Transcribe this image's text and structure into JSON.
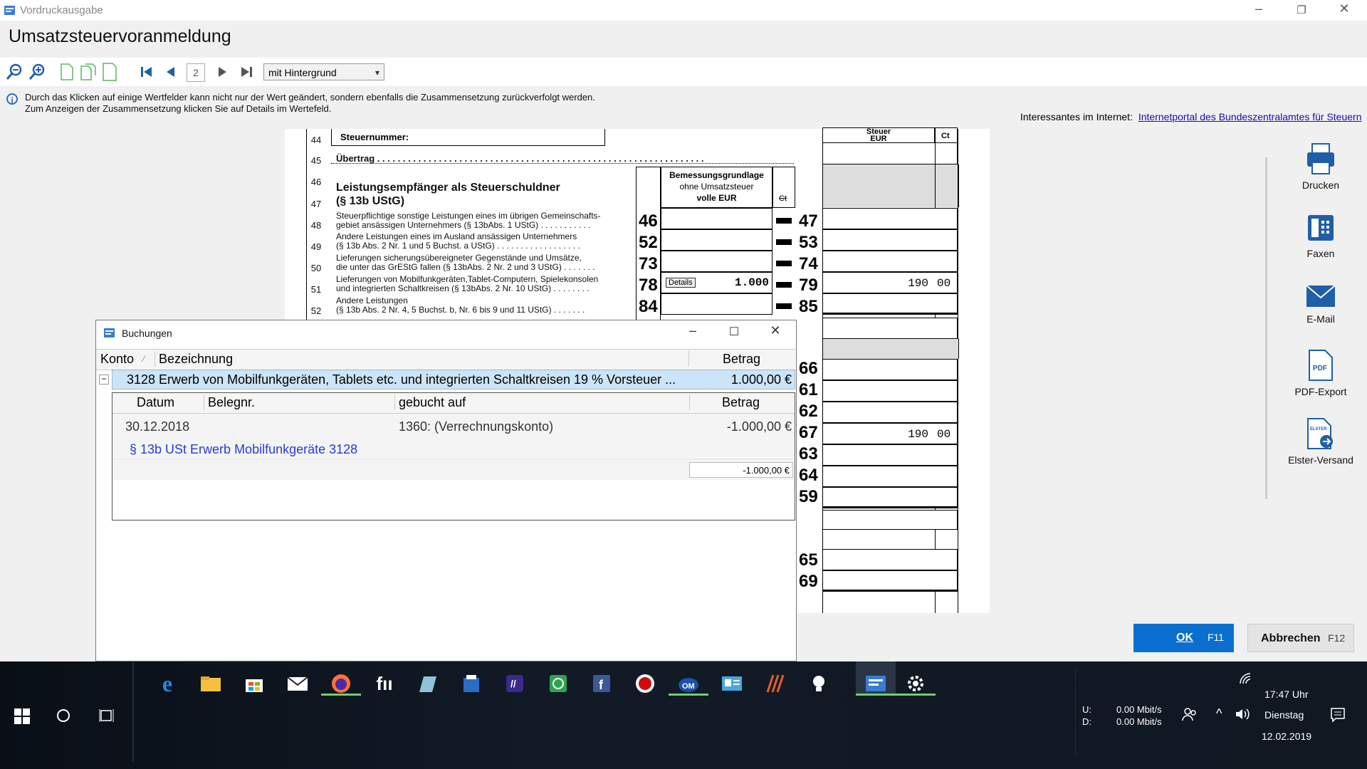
{
  "window": {
    "title": "Vordruckausgabe",
    "heading": "Umsatzsteuervoranmeldung"
  },
  "toolbar": {
    "page_number": "2",
    "view_select": "mit Hintergrund"
  },
  "info": {
    "line1": "Durch das Klicken auf einige Wertfelder kann nicht nur der Wert geändert, sondern ebenfalls die Zusammensetzung zurückverfolgt werden.",
    "line2": "Zum Anzeigen der Zusammensetzung klicken Sie auf Details im Wertefeld.",
    "internet_label": "Interessantes im Internet:",
    "internet_link": "Internetportal des Bundeszentralamtes für Steuern"
  },
  "form": {
    "rows": [
      "44",
      "45",
      "46",
      "47",
      "48",
      "49",
      "50",
      "51",
      "52"
    ],
    "steuernummer_label": "Steuernummer:",
    "uebertrag": "Übertrag",
    "section_title_1": "Leistungsempfänger als Steuerschuldner",
    "section_title_2": "(§ 13b UStG)",
    "basis_header_1": "Bemessungsgrundlage",
    "basis_header_2": "ohne Umsatzsteuer",
    "basis_header_3": "volle EUR",
    "basis_ct": "Ct",
    "tax_header_1": "Steuer",
    "tax_header_2": "EUR",
    "tax_ct": "Ct",
    "lines": [
      {
        "text1": "Steuerpflichtige sonstige Leistungen eines im übrigen Gemeinschafts-",
        "text2": "gebiet ansässigen Unternehmers (§ 13bAbs. 1 UStG) . . . . . . . . . . .",
        "code_base": "46",
        "code_tax": "47",
        "base": "",
        "tax_eur": "",
        "tax_ct": ""
      },
      {
        "text1": "Andere Leistungen eines im Ausland ansässigen Unternehmers",
        "text2": "(§ 13b Abs. 2 Nr. 1 und 5 Buchst. a UStG) . . . . . . . . . . . . . . . . . .",
        "code_base": "52",
        "code_tax": "53",
        "base": "",
        "tax_eur": "",
        "tax_ct": ""
      },
      {
        "text1": "Lieferungen sicherungsübereigneter Gegenstände und Umsätze,",
        "text2": "die unter das GrEStG fallen (§ 13bAbs. 2 Nr. 2 und 3 UStG) . . . . . . .",
        "code_base": "73",
        "code_tax": "74",
        "base": "",
        "tax_eur": "",
        "tax_ct": ""
      },
      {
        "text1": "Lieferungen von Mobilfunkgeräten,Tablet-Computern, Spielekonsolen",
        "text2": "und integrierten Schaltkreisen (§ 13bAbs. 2 Nr. 10 UStG) . . . . . . . .",
        "code_base": "78",
        "code_tax": "79",
        "base": "1.000",
        "tax_eur": "190",
        "tax_ct": "00",
        "details": "Details"
      },
      {
        "text1": "Andere Leistungen",
        "text2": "(§ 13b Abs. 2 Nr. 4, 5 Buchst. b, Nr. 6 bis 9 und 11 UStG) . . . . . . .",
        "code_base": "84",
        "code_tax": "85",
        "base": "",
        "tax_eur": "",
        "tax_ct": ""
      }
    ],
    "lower_codes": [
      {
        "code": "66",
        "eur": "",
        "ct": ""
      },
      {
        "code": "61",
        "eur": "",
        "ct": ""
      },
      {
        "code": "62",
        "eur": "",
        "ct": ""
      },
      {
        "code": "67",
        "eur": "190",
        "ct": "00"
      },
      {
        "code": "63",
        "eur": "",
        "ct": ""
      },
      {
        "code": "64",
        "eur": "",
        "ct": ""
      },
      {
        "code": "59",
        "eur": "",
        "ct": ""
      },
      {
        "code": "65",
        "eur": "",
        "ct": ""
      },
      {
        "code": "69",
        "eur": "",
        "ct": ""
      }
    ]
  },
  "sidebar": {
    "print": "Drucken",
    "fax": "Faxen",
    "email": "E-Mail",
    "pdf": "PDF-Export",
    "elster": "Elster-Versand",
    "pdf_badge": "PDF",
    "elster_badge": "ELSTER"
  },
  "buttons": {
    "ok": "OK",
    "ok_key": "F11",
    "cancel": "Abbrechen",
    "cancel_key": "F12"
  },
  "dialog": {
    "title": "Buchungen",
    "columns": {
      "konto": "Konto",
      "bezeichnung": "Bezeichnung",
      "betrag": "Betrag"
    },
    "group_row": {
      "expander": "−",
      "text": "3128 Erwerb von Mobilfunkgeräten, Tablets etc. und integrierten Schaltkreisen 19 % Vorsteuer ...",
      "amount": "1.000,00 €"
    },
    "sub_columns": {
      "datum": "Datum",
      "belegnr": "Belegnr.",
      "gebucht_auf": "gebucht auf",
      "betrag": "Betrag"
    },
    "sub_row": {
      "datum": "30.12.2018",
      "belegnr": "",
      "gebucht_auf": "1360: (Verrechnungskonto)",
      "betrag": "-1.000,00 €"
    },
    "sub_link": "§ 13b USt Erwerb Mobilfunkgeräte 3128",
    "sum": "-1.000,00 €"
  },
  "taskbar": {
    "network_u_label": "U:",
    "network_d_label": "D:",
    "network_u": "0.00 Mbit/s",
    "network_d": "0.00 Mbit/s",
    "time": "17:47 Uhr",
    "day": "Dienstag",
    "date": "12.02.2019",
    "apps": [
      "edge-icon",
      "explorer-icon",
      "store-icon",
      "mail-icon",
      "firefox-icon",
      "fii-icon",
      "notes-icon",
      "calculator-icon",
      "teams-icon",
      "whatsapp-icon",
      "facebook-icon",
      "record-icon",
      "outlook-icon",
      "contacts-icon",
      "winamp-icon",
      "tips-icon",
      "app-active-icon",
      "settings-icon"
    ]
  },
  "colors": {
    "accent": "#0b6fd0",
    "link": "#1a0dab",
    "selection": "#cce4f7"
  }
}
